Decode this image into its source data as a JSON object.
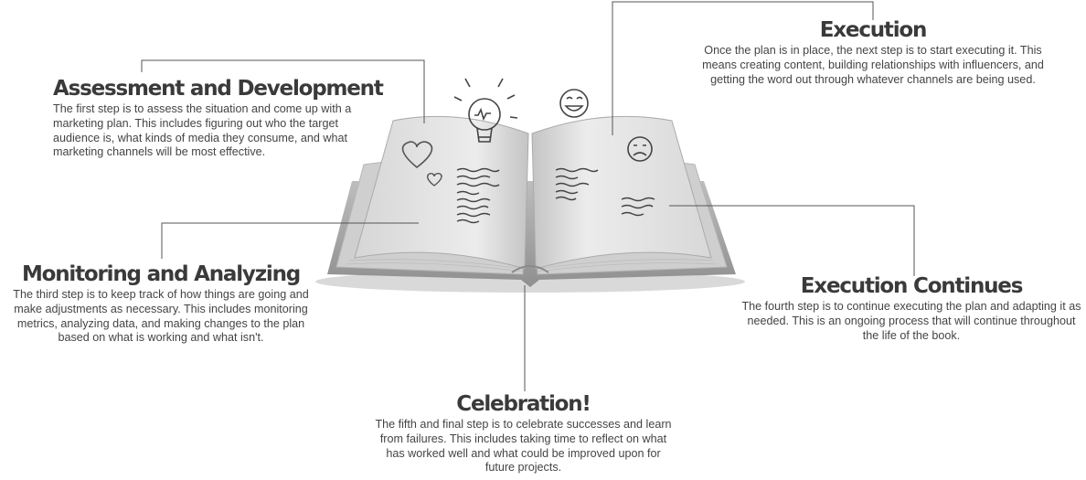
{
  "steps": {
    "assessment": {
      "title": "Assessment and Development",
      "text": "The first step is to assess the situation and come up with a marketing plan. This includes figuring out who the target audience is, what kinds of media they consume, and what marketing channels will be most effective."
    },
    "execution": {
      "title": "Execution",
      "text": "Once the plan is in place, the next step is to start executing it. This means creating content, building relationships with influencers, and getting the word out through whatever channels are being used."
    },
    "monitoring": {
      "title": "Monitoring and Analyzing",
      "text": "The third step is to keep track of how things are going and make adjustments as necessary. This includes monitoring metrics, analyzing data, and making changes to the plan based on what is working and what isn't."
    },
    "continues": {
      "title": "Execution Continues",
      "text": "The fourth step is to continue executing the plan and adapting it as needed. This is an ongoing process that will continue throughout the life of the book."
    },
    "celebration": {
      "title": "Celebration!",
      "text": "The fifth and final step is to celebrate successes and learn from failures. This includes taking time to reflect on what has worked well and what could be improved upon for future projects."
    }
  },
  "illustration": {
    "subject": "open-book",
    "doodles": [
      "lightbulb-icon",
      "smiley-face-icon",
      "sad-face-icon",
      "heart-icon",
      "small-heart-icon",
      "scribble-text"
    ],
    "colors": {
      "book": "#e6e6e6",
      "line": "#555555",
      "text": "#444444"
    }
  }
}
